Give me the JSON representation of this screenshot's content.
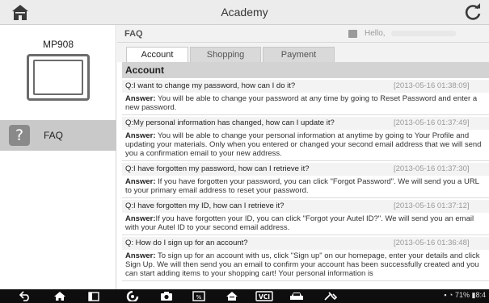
{
  "topbar": {
    "title": "Academy",
    "home_icon": "home-icon",
    "refresh_icon": "refresh-icon"
  },
  "left": {
    "device_name": "MP908",
    "faq_label": "FAQ"
  },
  "faq_header": {
    "title": "FAQ",
    "hello": "Hello,"
  },
  "tabs": [
    "Account",
    "Shopping",
    "Payment"
  ],
  "section_title": "Account",
  "answer_prefix": "Answer:",
  "questions": [
    {
      "q": "Q:I want to change my password, how can I do it?",
      "date": "[2013-05-16 01:38:09]",
      "a": " You will be able to change your password at any time by going to Reset Password and enter a new password."
    },
    {
      "q": "Q:My personal information has changed, how can I update it?",
      "date": "[2013-05-16 01:37:49]",
      "a": " You will be able to change your personal information at anytime by going to Your Profile and updating your materials. Only when you entered or changed your second email address that we will send you a confirmation email to your new address."
    },
    {
      "q": "Q:I have forgotten my password, how can I retrieve it?",
      "date": "[2013-05-16 01:37:30]",
      "a": " If you have forgotten your password, you can click \"Forgot Password\". We will send you a URL to your primary email address to reset your password."
    },
    {
      "q": "Q:I have forgotten my ID, how can I retrieve it?",
      "date": "[2013-05-16 01:37:12]",
      "a": "If you have forgotten your ID, you can click \"Forgot your Autel ID?\". We will send you an email with your Autel ID to your second email address."
    },
    {
      "q": "Q: How do I sign up for an account?",
      "date": "[2013-05-16 01:36:48]",
      "a": " To sign up for an account with us, click \"Sign up\" on our homepage, enter your details and click Sign Up. We will then send you an email to confirm your account has been successfully created and you can start adding items to your shopping cart! Your personal information is"
    }
  ],
  "navbar": {
    "icons": [
      "back-icon",
      "home-icon",
      "recents-icon",
      "camera-icon",
      "screenshot-icon",
      "vci-icon",
      "car-icon",
      "tools-icon"
    ],
    "vci_label": "VCI",
    "status": "71%",
    "clock": "8:4"
  },
  "colors": {
    "selected_item": "#c9c9c9",
    "section_bar": "#d3d3d3",
    "navbar": "#0e0e0e"
  }
}
